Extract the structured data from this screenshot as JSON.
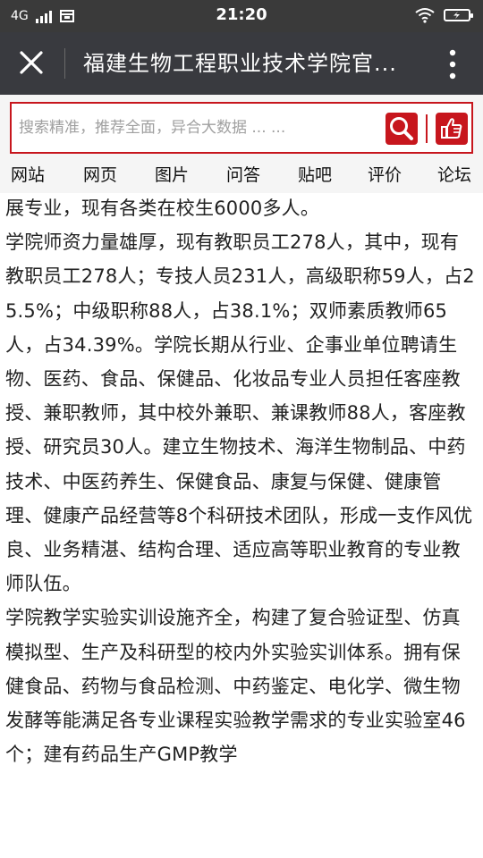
{
  "status_bar": {
    "network": "4G",
    "time": "21:20"
  },
  "title_bar": {
    "title": "福建生物工程职业技术学院官..."
  },
  "search": {
    "placeholder": "搜索精准，推荐全面，异合大数据 ... ..."
  },
  "nav_tabs": [
    "网站",
    "网页",
    "图片",
    "问答",
    "贴吧",
    "评价",
    "论坛"
  ],
  "article": {
    "paragraphs": [
      "展专业，现有各类在校生6000多人。",
      "学院师资力量雄厚，现有教职员工278人，其中，现有教职员工278人；专技人员231人，高级职称59人，占25.5%；中级职称88人，占38.1%；双师素质教师65人，占34.39%。学院长期从行业、企事业单位聘请生物、医药、食品、保健品、化妆品专业人员担任客座教授、兼职教师，其中校外兼职、兼课教师88人，客座教授、研究员30人。建立生物技术、海洋生物制品、中药技术、中医药养生、保健食品、康复与保健、健康管理、健康产品经营等8个科研技术团队，形成一支作风优良、业务精湛、结构合理、适应高等职业教育的专业教师队伍。",
      "学院教学实验实训设施齐全，构建了复合验证型、仿真模拟型、生产及科研型的校内外实验实训体系。拥有保健食品、药物与食品检测、中药鉴定、电化学、微生物发酵等能满足各专业课程实验教学需求的专业实验室46个；建有药品生产GMP教学"
    ]
  },
  "colors": {
    "status_bar_bg": "#3a3a3a",
    "title_bar_bg": "#393a3f",
    "accent_red": "#c7161d",
    "search_area_bg": "#f5f5f5",
    "article_text": "#222222"
  }
}
